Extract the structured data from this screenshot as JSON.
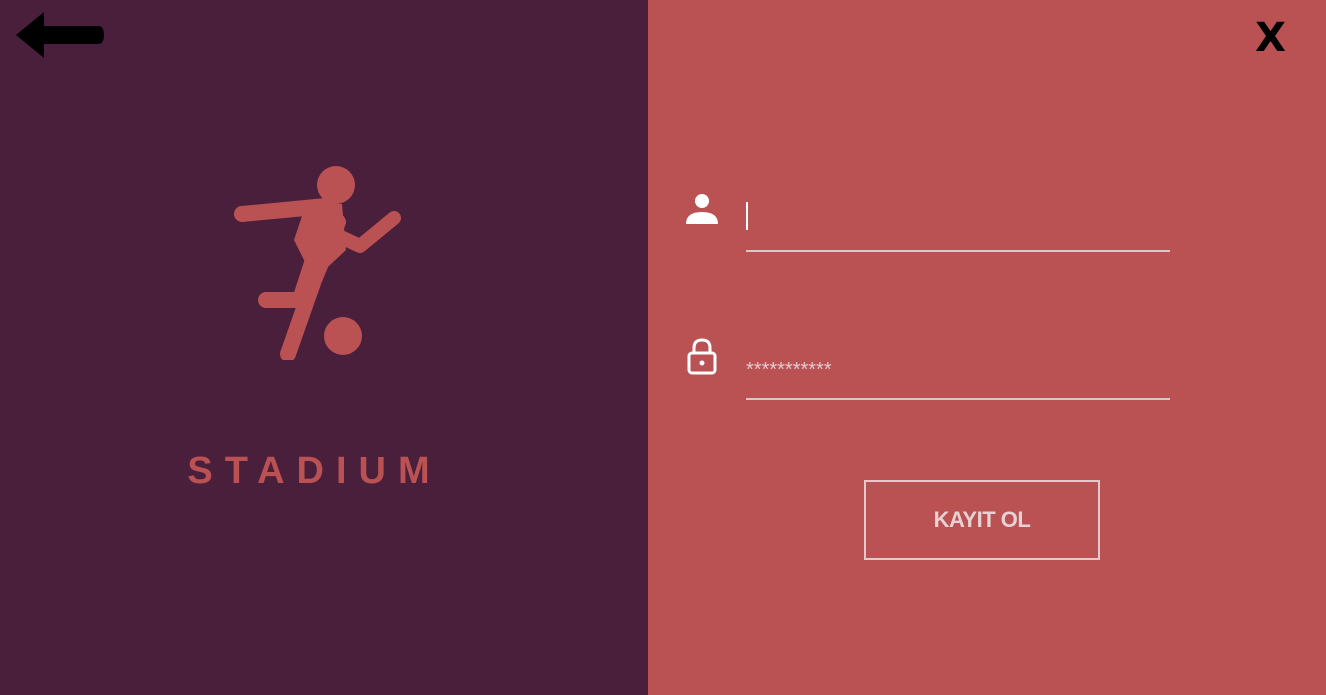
{
  "app": {
    "brand_name": "STADIUM",
    "logo_icon": "soccer-player-icon"
  },
  "nav": {
    "back_icon": "arrow-left-icon",
    "close_label": "X"
  },
  "form": {
    "username": {
      "icon": "user-icon",
      "value": "",
      "placeholder": ""
    },
    "password": {
      "icon": "lock-icon",
      "value": "",
      "placeholder": "***********"
    },
    "submit_label": "KAYIT OL"
  },
  "colors": {
    "left_panel": "#4a1f3c",
    "right_panel": "#ba5153",
    "accent": "#ba5153"
  }
}
